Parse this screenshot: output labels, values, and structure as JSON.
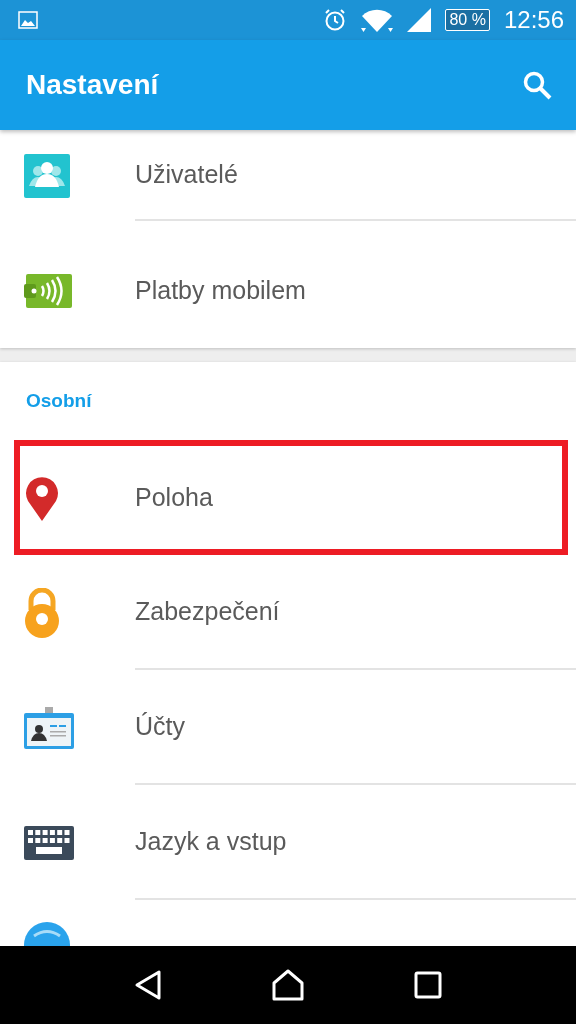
{
  "status_bar": {
    "battery": "80 %",
    "time": "12:56"
  },
  "toolbar": {
    "title": "Nastavení"
  },
  "sections": [
    {
      "items": [
        {
          "kind": "users",
          "label": "Uživatelé",
          "highlighted": false
        },
        {
          "kind": "payment",
          "label": "Platby mobilem",
          "highlighted": false
        }
      ]
    },
    {
      "header": "Osobní",
      "items": [
        {
          "kind": "location",
          "label": "Poloha",
          "highlighted": true
        },
        {
          "kind": "lock",
          "label": "Zabezpečení",
          "highlighted": false
        },
        {
          "kind": "account",
          "label": "Účty",
          "highlighted": false
        },
        {
          "kind": "keyboard",
          "label": "Jazyk a vstup",
          "highlighted": false
        },
        {
          "kind": "backup",
          "highlighted": false
        }
      ]
    }
  ]
}
